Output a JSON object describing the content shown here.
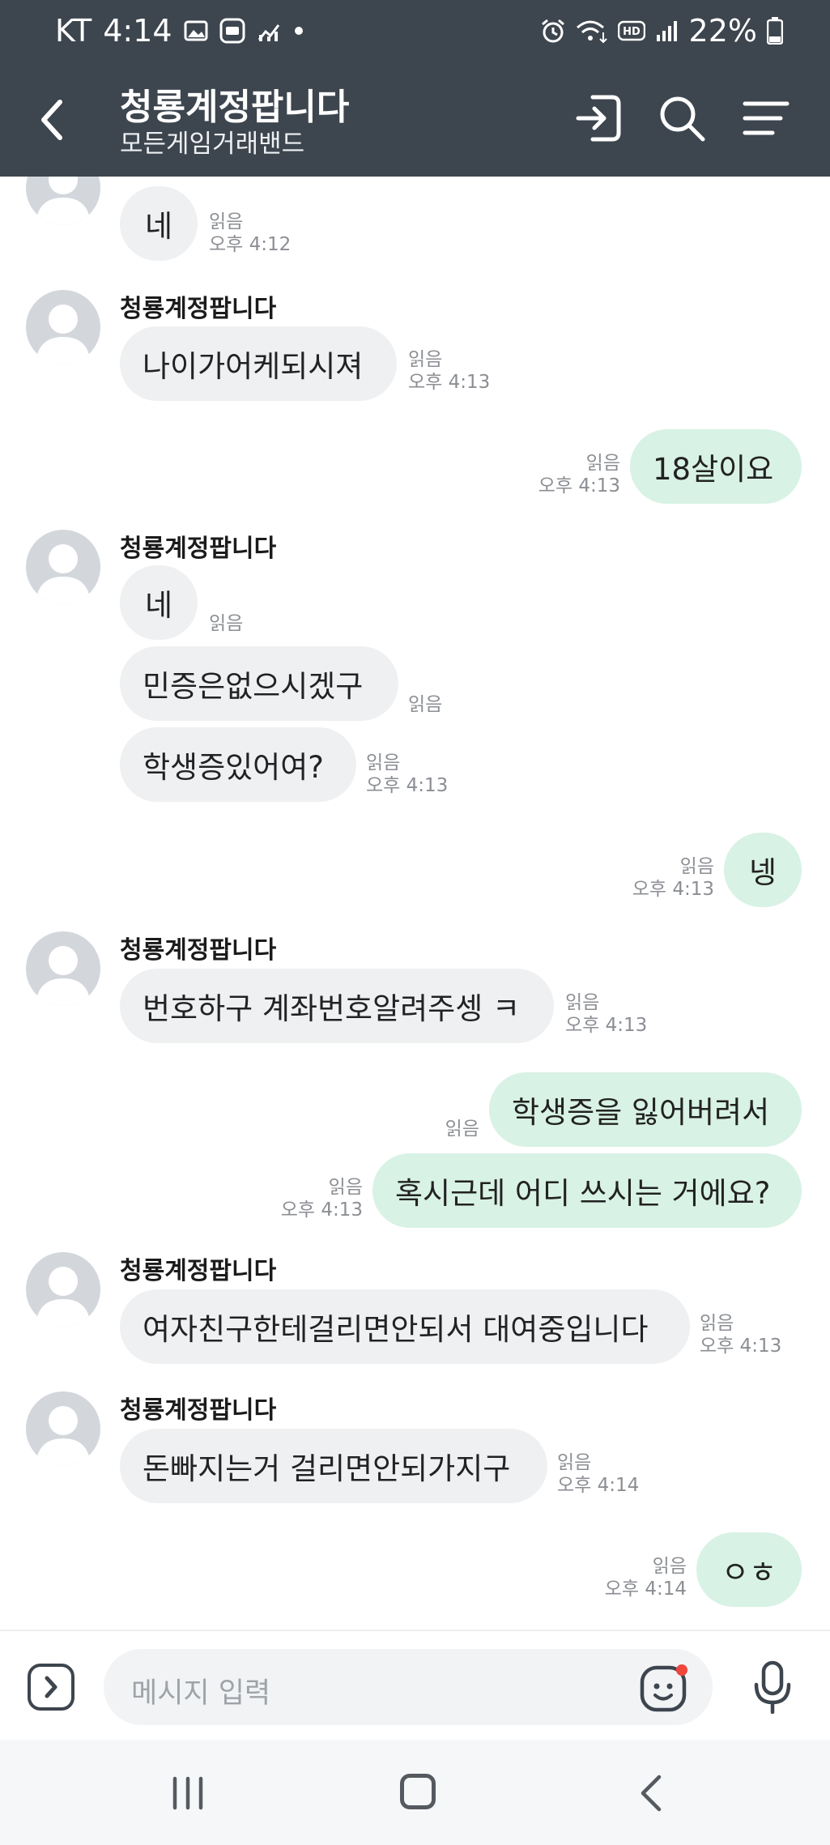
{
  "status_bar": {
    "carrier": "KT",
    "time": "4:14",
    "battery": "22%",
    "icons": [
      "gallery-icon",
      "app-icon",
      "chart-icon",
      "dot-icon",
      "alarm-icon",
      "wifi-icon",
      "hd-icon",
      "signal-icon",
      "battery-icon"
    ]
  },
  "header": {
    "title": "청룡계정팝니다",
    "subtitle": "모든게임거래밴드",
    "icons": [
      "back-arrow-icon",
      "enter-icon",
      "search-icon",
      "menu-icon"
    ]
  },
  "chat": {
    "messages": [
      {
        "from": "other",
        "sender": "",
        "text": "네",
        "read": "읽음",
        "time": "오후 4:12"
      },
      {
        "from": "other",
        "sender": "청룡계정팝니다",
        "text": "나이가어케되시져",
        "read": "읽음",
        "time": "오후 4:13"
      },
      {
        "from": "me",
        "text": "18살이요",
        "read": "읽음",
        "time": "오후 4:13"
      },
      {
        "from": "other",
        "sender": "청룡계정팝니다",
        "text": "네",
        "read": "읽음",
        "time": ""
      },
      {
        "from": "other",
        "sender": "",
        "text": "민증은없으시겠구",
        "read": "읽음",
        "time": ""
      },
      {
        "from": "other",
        "sender": "",
        "text": "학생증있어여?",
        "read": "읽음",
        "time": "오후 4:13"
      },
      {
        "from": "me",
        "text": "넹",
        "read": "읽음",
        "time": "오후 4:13"
      },
      {
        "from": "other",
        "sender": "청룡계정팝니다",
        "text": "번호하구 계좌번호알려주셍 ㅋ",
        "read": "읽음",
        "time": "오후 4:13"
      },
      {
        "from": "me",
        "text": "학생증을 잃어버려서",
        "read": "읽음",
        "time": ""
      },
      {
        "from": "me",
        "text": "혹시근데 어디 쓰시는 거에요?",
        "read": "읽음",
        "time": "오후 4:13"
      },
      {
        "from": "other",
        "sender": "청룡계정팝니다",
        "text": "여자친구한테걸리면안되서 대여중입니다",
        "read": "읽음",
        "time": "오후 4:13"
      },
      {
        "from": "other",
        "sender": "청룡계정팝니다",
        "text": "돈빠지는거 걸리면안되가지구",
        "read": "읽음",
        "time": "오후 4:14"
      },
      {
        "from": "me",
        "text": "ㅇㅎ",
        "read": "읽음",
        "time": "오후 4:14"
      }
    ]
  },
  "input": {
    "placeholder": "메시지 입력",
    "icons": [
      "expand-icon",
      "emoji-icon",
      "mic-icon"
    ]
  },
  "nav": {
    "icons": [
      "recent-apps-icon",
      "home-icon",
      "back-icon"
    ]
  },
  "colors": {
    "header_bg": "#3d454e",
    "incoming_bubble": "#eff0f2",
    "outgoing_bubble": "#d8f2e5",
    "meta_text": "#8b8e93",
    "notification_dot": "#f0463c"
  }
}
